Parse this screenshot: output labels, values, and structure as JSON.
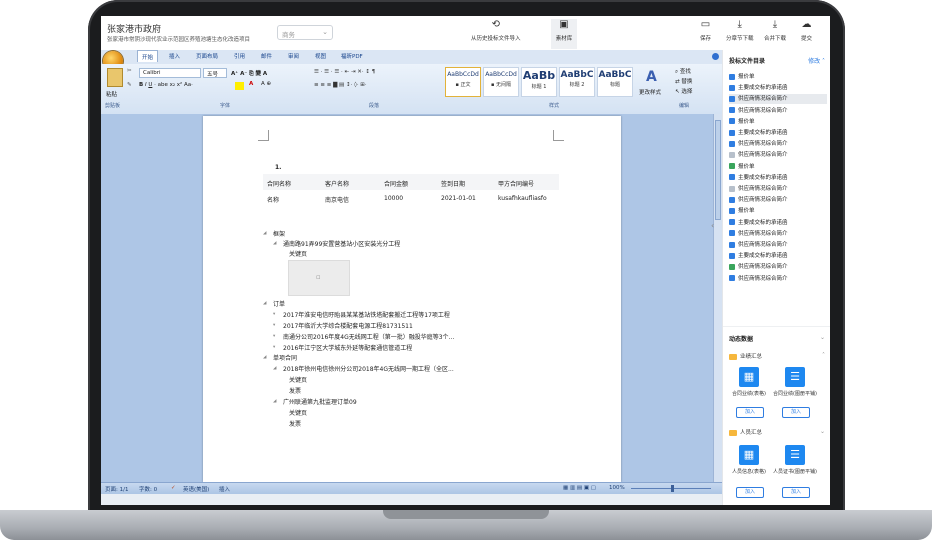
{
  "app": {
    "title": "张家港市政府",
    "subtitle": "张家港市常阴沙现代农业示范园区养殖池塘生态化改造项目",
    "select_value": "商务",
    "actions": {
      "history_import": "从历史投标文件导入",
      "material_lib": "素材库",
      "save": "保存",
      "chapter_download": "分章节下载",
      "merge_download": "合并下载",
      "submit": "提交"
    }
  },
  "word": {
    "tabs": [
      "开始",
      "插入",
      "页面布局",
      "引用",
      "邮件",
      "审阅",
      "视图",
      "福昕PDF"
    ],
    "font_name": "Calibri",
    "font_size": "五号",
    "styles": [
      {
        "preview": "AaBbCcDd",
        "name": "▪ 正文"
      },
      {
        "preview": "AaBbCcDd",
        "name": "▪ 无间隔"
      },
      {
        "preview": "AaBb",
        "name": "标题 1"
      },
      {
        "preview": "AaBbC",
        "name": "标题 2"
      },
      {
        "preview": "AaBbC",
        "name": "标题"
      }
    ],
    "change_style": "更改样式",
    "find": "查找",
    "replace": "替换",
    "select": "选择",
    "paste": "粘贴",
    "groups": {
      "clipboard": "剪贴板",
      "font": "字体",
      "paragraph": "段落",
      "styles": "样式",
      "edit": "编辑"
    },
    "status": {
      "page": "页面: 1/1",
      "words": "字数: 0",
      "lang": "英语(美国)",
      "mode": "插入",
      "zoom": "100%"
    }
  },
  "doc": {
    "marker": "1.",
    "table": {
      "headers": [
        "合同名称",
        "客户名称",
        "合同金额",
        "签到日期",
        "甲方合同编号"
      ],
      "rows": [
        [
          "名称",
          "南京电信",
          "10000",
          "2021-01-01",
          "kusafhkaufliasfo"
        ]
      ]
    },
    "tree": {
      "framework": "框架",
      "project1": "通南路91弄99安置营基站小区安装光分工程",
      "key_page": "关键页",
      "order": "订单",
      "items": [
        "2017年淮安电信盱眙县某某基站铁塔配套搬迁工程等17项工程",
        "2017年临沂大学综合楼配套电源工程81731511",
        "南通分公司2016年度4G无线网工程（第一批）融投华庭等3个...",
        "2016年江宁区大学城东外延等配套通信管道工程"
      ],
      "single_contract": "单项合同",
      "contract1": "2018年徐州电信徐州分公司2018年4G无线网一期工程（全区...",
      "key_page2": "关键页",
      "invoice": "发票",
      "contract2": "广州联通第九批监理订单09",
      "key_page3": "关键页",
      "invoice2": "发票"
    }
  },
  "panel": {
    "catalog_title": "投标文件目录",
    "edit": "修改",
    "files": [
      {
        "label": "报价单",
        "icon": "blue",
        "selected": false
      },
      {
        "label": "主要成交标的承诺函",
        "icon": "blue",
        "selected": false
      },
      {
        "label": "供应商情况综合简介",
        "icon": "blue",
        "selected": true
      },
      {
        "label": "供应商情况综合简介",
        "icon": "blue",
        "selected": false
      },
      {
        "label": "报价单",
        "icon": "blue",
        "selected": false
      },
      {
        "label": "主要成交标的承诺函",
        "icon": "blue",
        "selected": false
      },
      {
        "label": "供应商情况综合简介",
        "icon": "blue",
        "selected": false
      },
      {
        "label": "供应商情况综合简介",
        "icon": "gray",
        "selected": false
      },
      {
        "label": "报价单",
        "icon": "green",
        "selected": false
      },
      {
        "label": "主要成交标的承诺函",
        "icon": "blue",
        "selected": false
      },
      {
        "label": "供应商情况综合简介",
        "icon": "gray",
        "selected": false
      },
      {
        "label": "供应商情况综合简介",
        "icon": "blue",
        "selected": false
      },
      {
        "label": "报价单",
        "icon": "blue",
        "selected": false
      },
      {
        "label": "主要成交标的承诺函",
        "icon": "blue",
        "selected": false
      },
      {
        "label": "供应商情况综合简介",
        "icon": "blue",
        "selected": false
      },
      {
        "label": "供应商情况综合简介",
        "icon": "blue",
        "selected": false
      },
      {
        "label": "主要成交标的承诺函",
        "icon": "blue",
        "selected": false
      },
      {
        "label": "供应商情况综合简介",
        "icon": "green",
        "selected": false
      },
      {
        "label": "供应商情况综合简介",
        "icon": "blue",
        "selected": false
      }
    ],
    "dynamic_title": "动态数据",
    "group1": "业绩汇总",
    "group2": "人员汇总",
    "tiles": [
      {
        "label": "合同业绩(表格)",
        "add": "加入"
      },
      {
        "label": "合同业绩(图册平铺)",
        "add": "加入"
      },
      {
        "label": "人员信息(表格)",
        "add": "加入"
      },
      {
        "label": "人员证书(图册平铺)",
        "add": "加入"
      }
    ]
  }
}
